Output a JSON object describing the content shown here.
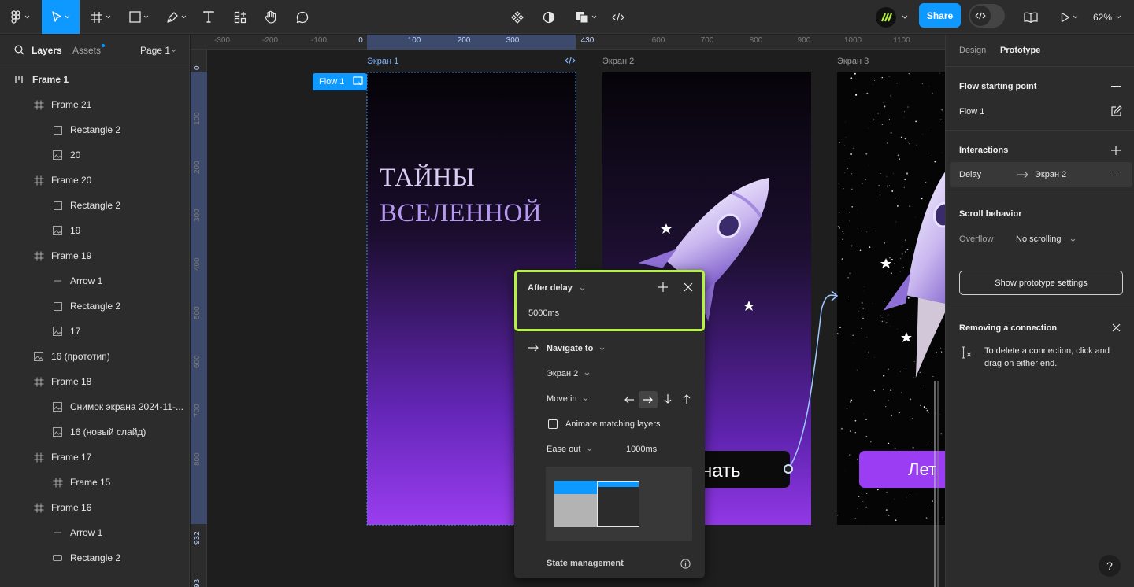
{
  "toolbar": {
    "share_label": "Share",
    "zoom": "62%"
  },
  "left_panel": {
    "tabs": {
      "layers": "Layers",
      "assets": "Assets"
    },
    "page": "Page 1",
    "layers": [
      {
        "name": "Frame 1",
        "icon": "frame-bars-icon",
        "depth": 0
      },
      {
        "name": "Frame 21",
        "icon": "frame-icon",
        "depth": 1
      },
      {
        "name": "Rectangle 2",
        "icon": "rectangle-icon",
        "depth": 2
      },
      {
        "name": "20",
        "icon": "image-icon",
        "depth": 2
      },
      {
        "name": "Frame 20",
        "icon": "frame-icon",
        "depth": 1
      },
      {
        "name": "Rectangle 2",
        "icon": "rectangle-icon",
        "depth": 2
      },
      {
        "name": "19",
        "icon": "image-icon",
        "depth": 2
      },
      {
        "name": "Frame 19",
        "icon": "frame-icon",
        "depth": 1
      },
      {
        "name": "Arrow 1",
        "icon": "line-icon",
        "depth": 2
      },
      {
        "name": "Rectangle 2",
        "icon": "rectangle-icon",
        "depth": 2
      },
      {
        "name": "17",
        "icon": "image-icon",
        "depth": 2
      },
      {
        "name": "16 (прототип)",
        "icon": "image-icon",
        "depth": 1
      },
      {
        "name": "Frame 18",
        "icon": "frame-icon",
        "depth": 1
      },
      {
        "name": "Снимок экрана 2024-11-...",
        "icon": "image-icon",
        "depth": 2
      },
      {
        "name": "16 (новый слайд)",
        "icon": "image-icon",
        "depth": 2
      },
      {
        "name": "Frame 17",
        "icon": "frame-icon",
        "depth": 1
      },
      {
        "name": "Frame 15",
        "icon": "frame-icon",
        "depth": 2
      },
      {
        "name": "Frame 16",
        "icon": "frame-icon",
        "depth": 1
      },
      {
        "name": "Arrow 1",
        "icon": "line-icon",
        "depth": 2
      },
      {
        "name": "Rectangle 2",
        "icon": "rounded-rect-icon",
        "depth": 2
      }
    ]
  },
  "rulers": {
    "top": [
      "-300",
      "-200",
      "-100",
      "0",
      "100",
      "200",
      "300",
      "430",
      "600",
      "700",
      "800",
      "900",
      "1000",
      "1100"
    ],
    "left": [
      "0",
      "100",
      "200",
      "300",
      "400",
      "500",
      "600",
      "700",
      "800",
      "932",
      "93:"
    ]
  },
  "canvas": {
    "frames": [
      "Экран 1",
      "Экран 2",
      "Экран 3"
    ],
    "flow_badge": "Flow 1",
    "screen1_title": [
      "ТАЙНЫ",
      "ВСЕЛЕННОЙ"
    ],
    "screen2_button": "нать",
    "screen3_button": "Лет"
  },
  "popup": {
    "trigger": "After delay",
    "delay": "5000ms",
    "action": "Navigate to",
    "destination": "Экран 2",
    "animation": "Move in",
    "animate_matching": "Animate matching layers",
    "easing": "Ease out",
    "duration": "1000ms",
    "state_management": "State management"
  },
  "right_panel": {
    "tabs": {
      "design": "Design",
      "prototype": "Prototype"
    },
    "flow_starting_point": "Flow starting point",
    "flow_name": "Flow 1",
    "interactions": "Interactions",
    "interaction": {
      "trigger": "Delay",
      "target": "Экран 2"
    },
    "scroll_behavior": "Scroll behavior",
    "overflow_label": "Overflow",
    "overflow_value": "No scrolling",
    "show_settings": "Show prototype settings",
    "removing_title": "Removing a connection",
    "removing_text": "To delete a connection, click and drag on either end."
  },
  "colors": {
    "accent": "#0d99ff",
    "highlight": "#b5f23d",
    "purple": "#9b3df2"
  }
}
